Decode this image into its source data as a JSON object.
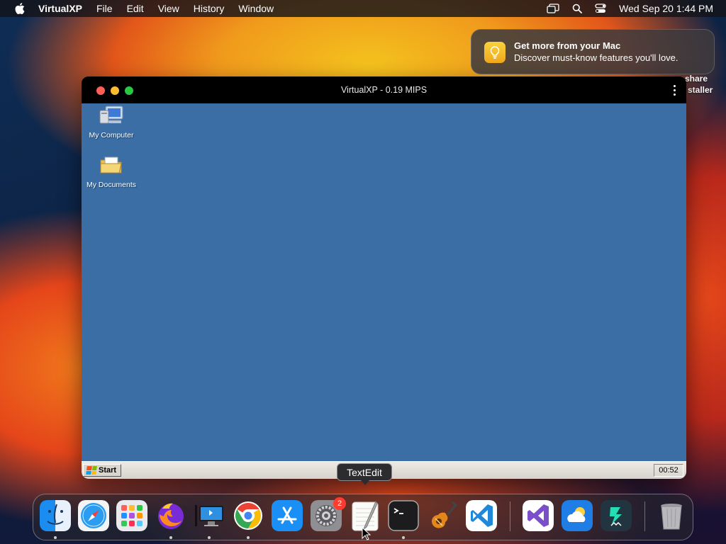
{
  "menubar": {
    "app_name": "VirtualXP",
    "items": [
      "File",
      "Edit",
      "View",
      "History",
      "Window"
    ],
    "clock": "Wed Sep 20  1:44 PM",
    "icons": [
      "apple-icon",
      "screen-mirroring-icon",
      "spotlight-search-icon",
      "control-center-icon"
    ]
  },
  "notification": {
    "title": "Get more from your Mac",
    "body": "Discover must-know features you'll love.",
    "icon": "lightbulb-icon"
  },
  "desktop_labels": [
    "share",
    "staller"
  ],
  "window": {
    "title": "VirtualXP - 0.19 MIPS",
    "desktop_icons": [
      {
        "label": "My Computer",
        "icon": "my-computer-icon"
      },
      {
        "label": "My Documents",
        "icon": "my-documents-icon"
      }
    ],
    "taskbar": {
      "start_label": "Start",
      "clock": "00:52"
    }
  },
  "tooltip": {
    "text": "TextEdit"
  },
  "dock": {
    "badge": "2",
    "apps": [
      "Finder",
      "Safari",
      "Launchpad",
      "Firefox",
      "Remote Desktop",
      "Chrome",
      "App Store",
      "System Settings",
      "TextEdit",
      "Terminal",
      "GarageBand",
      "VS Code",
      "Visual Studio",
      "Weather",
      "Filmora",
      "Trash"
    ]
  },
  "colors": {
    "xp_desktop": "#3a6ea5",
    "close": "#fe5f57",
    "minimize": "#febc2e",
    "maximize": "#28c840"
  }
}
